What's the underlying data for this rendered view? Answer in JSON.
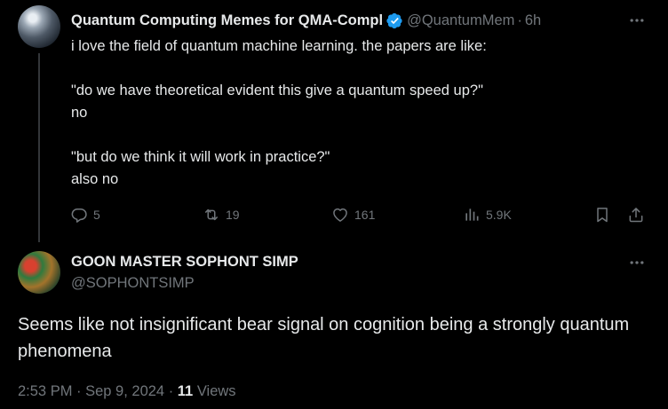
{
  "colors": {
    "background": "#000000",
    "text_primary": "#e7e9ea",
    "text_secondary": "#71767b",
    "verified_blue": "#1d9bf0",
    "thread_line": "#333639"
  },
  "parent_tweet": {
    "author_name": "Quantum Computing Memes for QMA-Compl",
    "verified_icon": "verified-badge-icon",
    "handle": "@QuantumMem",
    "separator": "·",
    "time": "6h",
    "more_icon": "more-horizontal-icon",
    "text_lines": [
      "i love the field of quantum machine learning. the papers are like:",
      "\"do we have theoretical evident this give a quantum speed up?\"",
      "no",
      "\"but do we think it will work in practice?\"",
      "also no"
    ],
    "actions": {
      "replies": "5",
      "reposts": "19",
      "likes": "161",
      "views": "5.9K"
    }
  },
  "reply_tweet": {
    "author_name": "GOON MASTER SOPHONT SIMP",
    "handle": "@SOPHONTSIMP",
    "more_icon": "more-horizontal-icon",
    "text": "Seems like not insignificant bear signal on cognition being a strongly quantum phenomena",
    "timestamp": "2:53 PM · Sep 9, 2024 · ",
    "views_count": "11",
    "views_label": " Views"
  }
}
